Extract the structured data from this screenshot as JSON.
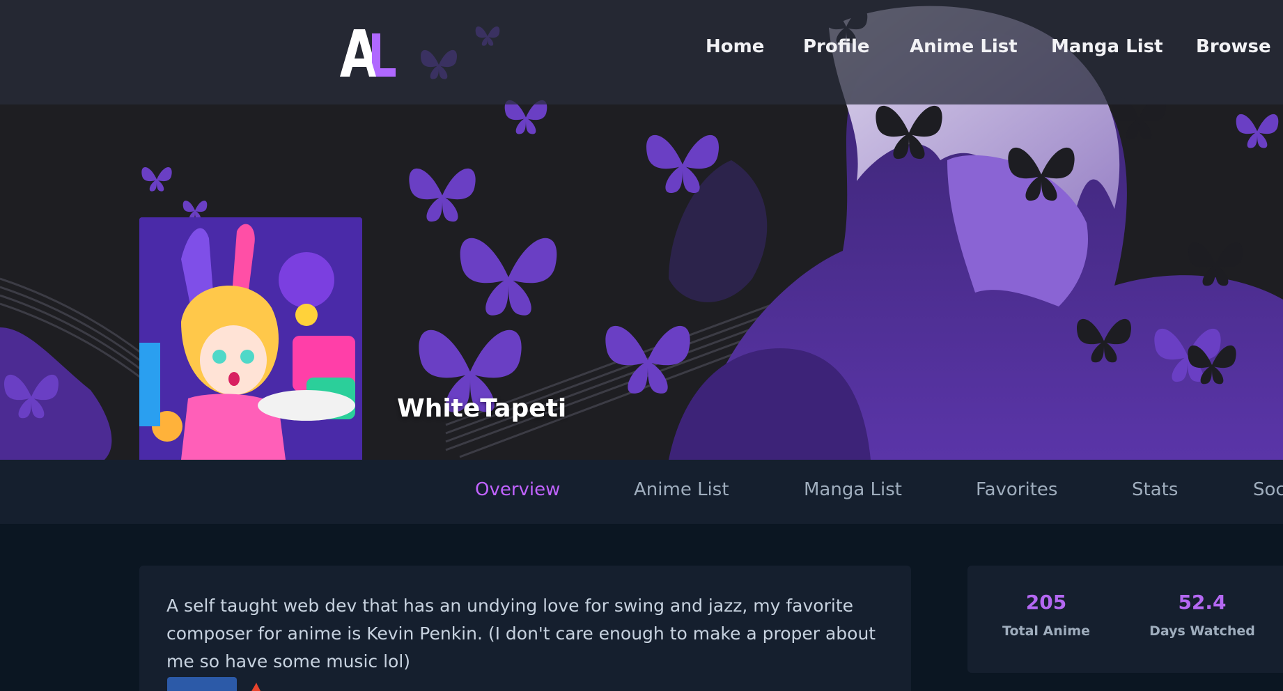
{
  "nav": {
    "logo_text": "AL",
    "links": [
      "Home",
      "Profile",
      "Anime List",
      "Manga List",
      "Browse"
    ]
  },
  "profile": {
    "username": "WhiteTapeti"
  },
  "tabs": {
    "items": [
      "Overview",
      "Anime List",
      "Manga List",
      "Favorites",
      "Stats",
      "Soc"
    ],
    "active": "Overview"
  },
  "about": {
    "text": "A self taught web dev that has an undying love for swing and jazz, my favorite composer for anime is Kevin Penkin. (I don't care enough to make a proper about me so have some music lol)"
  },
  "stats": [
    {
      "value": "205",
      "label": "Total Anime"
    },
    {
      "value": "52.4",
      "label": "Days Watched"
    }
  ],
  "colors": {
    "accent": "#c063ff",
    "stat_value": "#b468f2",
    "page_bg": "#0b1622",
    "card_bg": "#151f2e",
    "tab_text": "#9fadbd",
    "butterfly": "#6a3fc4"
  }
}
